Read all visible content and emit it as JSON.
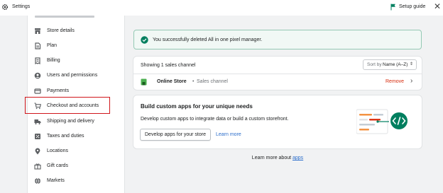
{
  "header": {
    "title": "Settings",
    "setup_guide": "Setup guide",
    "close_symbol": "✕"
  },
  "sidebar": {
    "items": [
      {
        "label": "Store details",
        "icon": "store-icon"
      },
      {
        "label": "Plan",
        "icon": "plan-icon"
      },
      {
        "label": "Billing",
        "icon": "billing-icon"
      },
      {
        "label": "Users and permissions",
        "icon": "user-icon"
      },
      {
        "label": "Payments",
        "icon": "payments-icon"
      },
      {
        "label": "Checkout and accounts",
        "icon": "cart-icon",
        "highlighted": true
      },
      {
        "label": "Shipping and delivery",
        "icon": "truck-icon"
      },
      {
        "label": "Taxes and duties",
        "icon": "taxes-icon"
      },
      {
        "label": "Locations",
        "icon": "location-pin-icon"
      },
      {
        "label": "Gift cards",
        "icon": "gift-icon"
      },
      {
        "label": "Markets",
        "icon": "globe-icon"
      }
    ]
  },
  "banner": {
    "message": "You successfully deleted All in one pixel manager."
  },
  "channels": {
    "count_label": "Showing 1 sales channel",
    "sort_label": "Sort by",
    "sort_value": "Name (A–Z)",
    "rows": [
      {
        "name": "Online Store",
        "separator": "•",
        "subtitle": "Sales channel",
        "action": "Remove"
      }
    ]
  },
  "apps_card": {
    "title": "Build custom apps for your unique needs",
    "description": "Develop custom apps to integrate data or build a custom storefront.",
    "button": "Develop apps for your store",
    "link": "Learn more"
  },
  "footer": {
    "prefix": "Learn more about ",
    "link": "apps"
  },
  "colors": {
    "accent": "#2c6ecb",
    "success": "#007f5f",
    "highlight_border": "#d0161b",
    "remove": "#d72c0d"
  }
}
